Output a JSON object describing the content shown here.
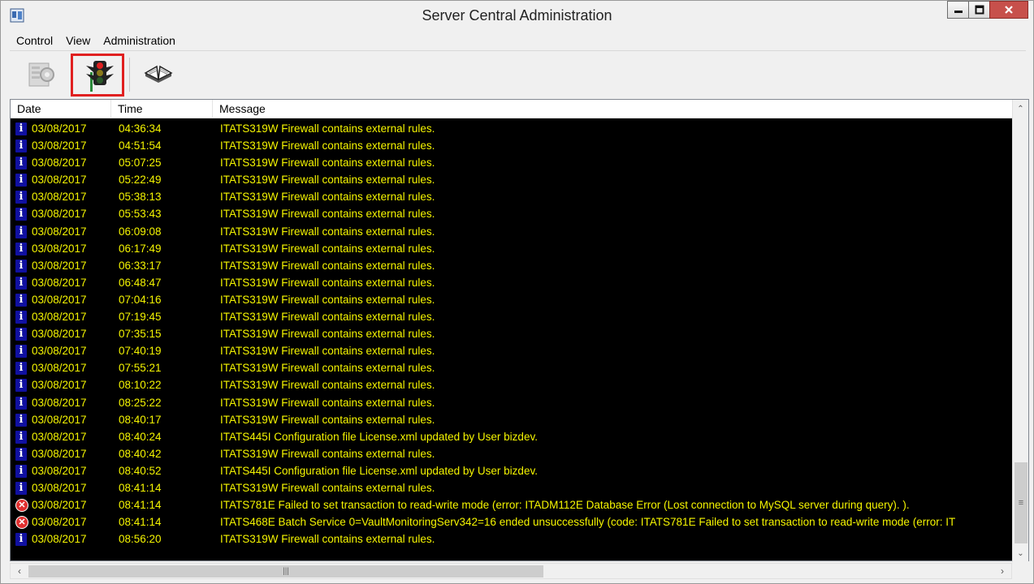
{
  "window": {
    "title": "Server Central Administration"
  },
  "menu": {
    "items": [
      "Control",
      "View",
      "Administration"
    ]
  },
  "toolbar": {
    "tools": [
      {
        "icon": "server-gear-icon",
        "state": "disabled"
      },
      {
        "icon": "traffic-light-icon",
        "state": "highlighted"
      },
      {
        "icon": "open-book-icon",
        "state": "normal"
      }
    ]
  },
  "log": {
    "columns": [
      "Date",
      "Time",
      "Message"
    ],
    "rows": [
      {
        "type": "info",
        "date": "03/08/2017",
        "time": "04:36:34",
        "message": "ITATS319W Firewall contains external rules."
      },
      {
        "type": "info",
        "date": "03/08/2017",
        "time": "04:51:54",
        "message": "ITATS319W Firewall contains external rules."
      },
      {
        "type": "info",
        "date": "03/08/2017",
        "time": "05:07:25",
        "message": "ITATS319W Firewall contains external rules."
      },
      {
        "type": "info",
        "date": "03/08/2017",
        "time": "05:22:49",
        "message": "ITATS319W Firewall contains external rules."
      },
      {
        "type": "info",
        "date": "03/08/2017",
        "time": "05:38:13",
        "message": "ITATS319W Firewall contains external rules."
      },
      {
        "type": "info",
        "date": "03/08/2017",
        "time": "05:53:43",
        "message": "ITATS319W Firewall contains external rules."
      },
      {
        "type": "info",
        "date": "03/08/2017",
        "time": "06:09:08",
        "message": "ITATS319W Firewall contains external rules."
      },
      {
        "type": "info",
        "date": "03/08/2017",
        "time": "06:17:49",
        "message": "ITATS319W Firewall contains external rules."
      },
      {
        "type": "info",
        "date": "03/08/2017",
        "time": "06:33:17",
        "message": "ITATS319W Firewall contains external rules."
      },
      {
        "type": "info",
        "date": "03/08/2017",
        "time": "06:48:47",
        "message": "ITATS319W Firewall contains external rules."
      },
      {
        "type": "info",
        "date": "03/08/2017",
        "time": "07:04:16",
        "message": "ITATS319W Firewall contains external rules."
      },
      {
        "type": "info",
        "date": "03/08/2017",
        "time": "07:19:45",
        "message": "ITATS319W Firewall contains external rules."
      },
      {
        "type": "info",
        "date": "03/08/2017",
        "time": "07:35:15",
        "message": "ITATS319W Firewall contains external rules."
      },
      {
        "type": "info",
        "date": "03/08/2017",
        "time": "07:40:19",
        "message": "ITATS319W Firewall contains external rules."
      },
      {
        "type": "info",
        "date": "03/08/2017",
        "time": "07:55:21",
        "message": "ITATS319W Firewall contains external rules."
      },
      {
        "type": "info",
        "date": "03/08/2017",
        "time": "08:10:22",
        "message": "ITATS319W Firewall contains external rules."
      },
      {
        "type": "info",
        "date": "03/08/2017",
        "time": "08:25:22",
        "message": "ITATS319W Firewall contains external rules."
      },
      {
        "type": "info",
        "date": "03/08/2017",
        "time": "08:40:17",
        "message": "ITATS319W Firewall contains external rules."
      },
      {
        "type": "info",
        "date": "03/08/2017",
        "time": "08:40:24",
        "message": "ITATS445I Configuration file License.xml updated by User bizdev."
      },
      {
        "type": "info",
        "date": "03/08/2017",
        "time": "08:40:42",
        "message": "ITATS319W Firewall contains external rules."
      },
      {
        "type": "info",
        "date": "03/08/2017",
        "time": "08:40:52",
        "message": "ITATS445I Configuration file License.xml updated by User bizdev."
      },
      {
        "type": "info",
        "date": "03/08/2017",
        "time": "08:41:14",
        "message": "ITATS319W Firewall contains external rules."
      },
      {
        "type": "error",
        "date": "03/08/2017",
        "time": "08:41:14",
        "message": "ITATS781E Failed to set transaction to read-write mode (error: ITADM112E Database Error (Lost connection to MySQL server during query). )."
      },
      {
        "type": "error",
        "date": "03/08/2017",
        "time": "08:41:14",
        "message": "ITATS468E Batch Service 0=VaultMonitoringServ342=16 ended unsuccessfully (code: ITATS781E Failed to set transaction to read-write mode (error: IT"
      },
      {
        "type": "info",
        "date": "03/08/2017",
        "time": "08:56:20",
        "message": "ITATS319W Firewall contains external rules."
      }
    ]
  },
  "colors": {
    "log_background": "#000000",
    "log_text": "#f5f500",
    "info_icon": "#1010a0",
    "error_icon": "#e03030",
    "highlight_border": "#e02020"
  }
}
